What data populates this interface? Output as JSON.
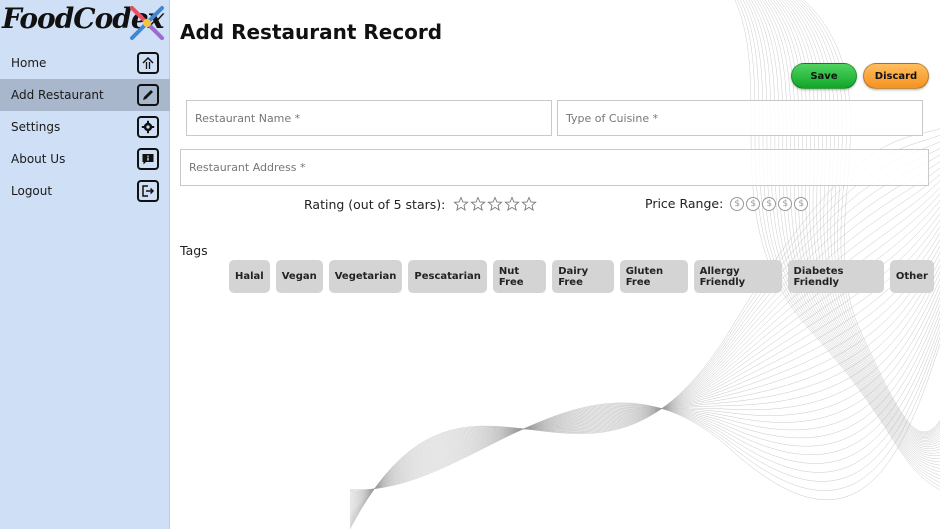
{
  "app": {
    "logo_text": "FoodCodex",
    "logo_icon": "crossed-utensils-logo"
  },
  "sidebar": {
    "items": [
      {
        "label": "Home",
        "icon": "home-fork-icon",
        "active": false
      },
      {
        "label": "Add Restaurant",
        "icon": "pencil-icon",
        "active": true
      },
      {
        "label": "Settings",
        "icon": "gear-icon",
        "active": false
      },
      {
        "label": "About Us",
        "icon": "chat-info-icon",
        "active": false
      },
      {
        "label": "Logout",
        "icon": "logout-icon",
        "active": false
      }
    ]
  },
  "main": {
    "title": "Add Restaurant Record",
    "save_label": "Save",
    "discard_label": "Discard",
    "fields": {
      "name_placeholder": "Restaurant Name *",
      "cuisine_placeholder": "Type of Cuisine *",
      "address_placeholder": "Restaurant Address *"
    },
    "rating_label": "Rating (out of 5 stars):",
    "rating_value": 0,
    "rating_max": 5,
    "price_label": "Price Range:",
    "price_symbol": "$",
    "price_value": 0,
    "price_max": 5,
    "tags_label": "Tags",
    "tags": [
      "Halal",
      "Vegan",
      "Vegetarian",
      "Pescatarian",
      "Nut Free",
      "Dairy Free",
      "Gluten Free",
      "Allergy Friendly",
      "Diabetes Friendly",
      "Other"
    ]
  },
  "colors": {
    "sidebar_bg": "#cfdff6",
    "sidebar_active": "#a9b7cc",
    "save": "#1fb335",
    "discard": "#f7a13a",
    "tag_bg": "#d4d4d4"
  }
}
